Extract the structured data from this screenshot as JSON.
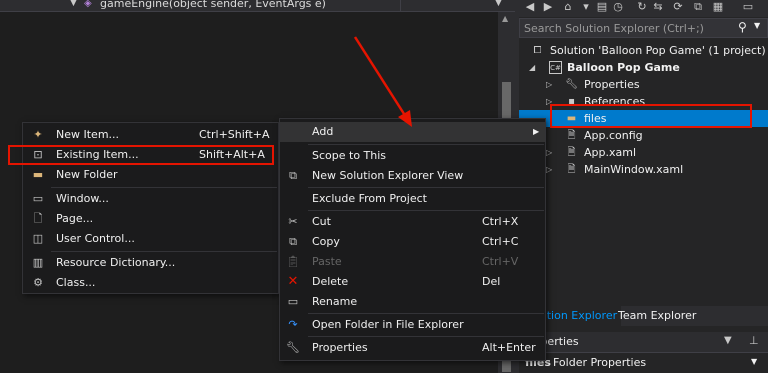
{
  "editor": {
    "method_signature": "gameEngine(object sender, EventArgs e)"
  },
  "solution_explorer": {
    "search_placeholder": "Search Solution Explorer (Ctrl+;)",
    "tree": [
      {
        "label": "Solution 'Balloon Pop Game' (1 project)",
        "icon": "solution-icon"
      },
      {
        "label": "Balloon Pop Game",
        "icon": "csharp-project-icon"
      },
      {
        "label": "Properties",
        "icon": "wrench-icon"
      },
      {
        "label": "References",
        "icon": "references-icon"
      },
      {
        "label": "files",
        "icon": "folder-icon"
      },
      {
        "label": "App.config",
        "icon": "config-file-icon"
      },
      {
        "label": "App.xaml",
        "icon": "xaml-file-icon"
      },
      {
        "label": "MainWindow.xaml",
        "icon": "xaml-file-icon"
      }
    ],
    "tabs": [
      "Solution Explorer",
      "Team Explorer"
    ],
    "properties_title": "Properties",
    "properties_row": {
      "name": "files",
      "value": "Folder Properties"
    }
  },
  "add_submenu": {
    "items": [
      {
        "label": "New Item...",
        "shortcut": "Ctrl+Shift+A",
        "icon": "new-item-icon"
      },
      {
        "label": "Existing Item...",
        "shortcut": "Shift+Alt+A",
        "icon": "existing-item-icon"
      },
      {
        "label": "New Folder",
        "shortcut": "",
        "icon": "new-folder-icon"
      },
      {
        "label": "Window...",
        "shortcut": "",
        "icon": "window-icon"
      },
      {
        "label": "Page...",
        "shortcut": "",
        "icon": "page-icon"
      },
      {
        "label": "User Control...",
        "shortcut": "",
        "icon": "user-control-icon"
      },
      {
        "label": "Resource Dictionary...",
        "shortcut": "",
        "icon": "resource-dictionary-icon"
      },
      {
        "label": "Class...",
        "shortcut": "",
        "icon": "class-icon"
      }
    ]
  },
  "context_menu": {
    "items": [
      {
        "label": "Add",
        "shortcut": "",
        "icon": ""
      },
      {
        "label": "Scope to This",
        "shortcut": "",
        "icon": ""
      },
      {
        "label": "New Solution Explorer View",
        "shortcut": "",
        "icon": "new-view-icon"
      },
      {
        "label": "Exclude From Project",
        "shortcut": "",
        "icon": ""
      },
      {
        "label": "Cut",
        "shortcut": "Ctrl+X",
        "icon": "cut-icon"
      },
      {
        "label": "Copy",
        "shortcut": "Ctrl+C",
        "icon": "copy-icon"
      },
      {
        "label": "Paste",
        "shortcut": "Ctrl+V",
        "icon": "paste-icon"
      },
      {
        "label": "Delete",
        "shortcut": "Del",
        "icon": "delete-icon"
      },
      {
        "label": "Rename",
        "shortcut": "",
        "icon": "rename-icon"
      },
      {
        "label": "Open Folder in File Explorer",
        "shortcut": "",
        "icon": "refresh-icon"
      },
      {
        "label": "Properties",
        "shortcut": "Alt+Enter",
        "icon": "wrench-icon"
      }
    ]
  },
  "colors": {
    "accent": "#007acc",
    "highlight_box": "#e51400",
    "menu_bg": "#1b1b1c",
    "delete_icon": "#e51400"
  }
}
